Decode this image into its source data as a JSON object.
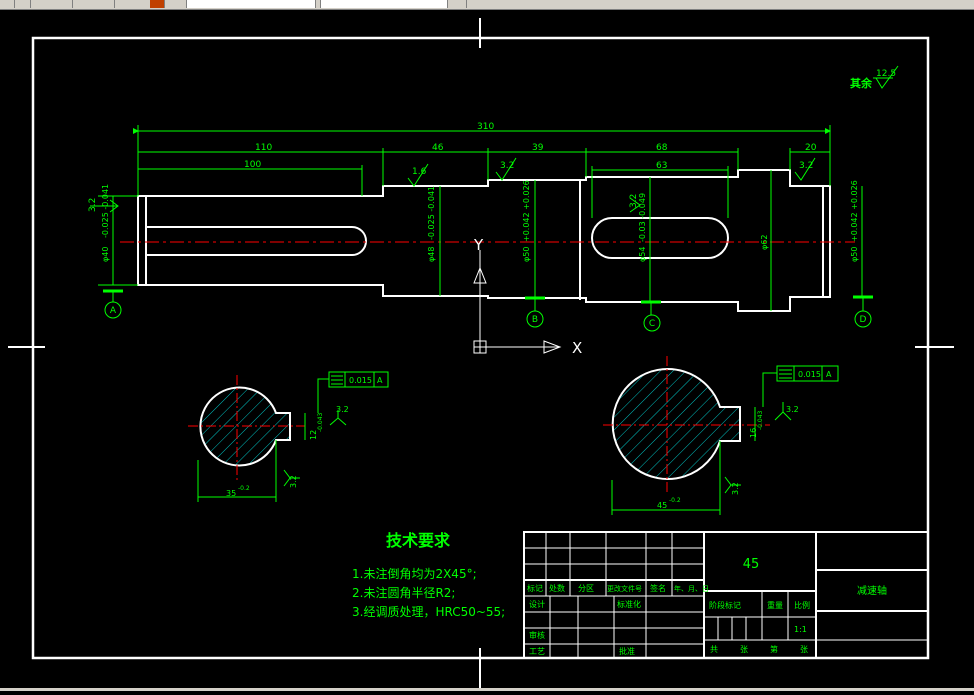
{
  "colors": {
    "background": "#000000",
    "frame": "#ffffff",
    "dimension": "#00ff00",
    "centerline": "#ff0000",
    "hatch": "#00c0c0",
    "text": "#00ff00"
  },
  "toolbar": {
    "icons": [
      "new-file-icon",
      "open-file-icon",
      "pan-icon",
      "undo-icon",
      "layer-icon",
      "properties-icon",
      "help-icon"
    ]
  },
  "drawing": {
    "roughness_note": {
      "label": "其余",
      "value": "12.5"
    },
    "dims_top": {
      "total": "310",
      "d110": "110",
      "d100": "100",
      "d46": "46",
      "d39": "39",
      "d68": "68",
      "d63": "63",
      "d20": "20"
    },
    "roughness": {
      "r1": "1.6",
      "r2": "3.2",
      "r3": "3.2",
      "r4": "3.2",
      "r5": "3.2",
      "r6": "3.2"
    },
    "diameters": {
      "d40": "φ40",
      "d40_tol": "-0.025 -0.041",
      "d48": "φ48",
      "d48_tol": "-0.025 -0.041",
      "d50a": "φ50",
      "d50a_tol": "+0.042 +0.026",
      "d54": "φ54",
      "d54_tol": "-0.03 -0.049",
      "d62": "φ62",
      "d50b": "φ50",
      "d50b_tol": "+0.042 +0.026"
    },
    "datums": [
      "A",
      "B",
      "C",
      "D"
    ],
    "axes": {
      "y": "Y",
      "x": "X"
    },
    "section_left": {
      "tolerance": "0.015",
      "datum": "A",
      "key_dim": "12",
      "key_tol": "-0.043",
      "diameter": "35",
      "diameter_tol": "-0.2",
      "roughness_a": "3.2",
      "roughness_b": "3.2"
    },
    "section_right": {
      "tolerance": "0.015",
      "datum": "A",
      "key_dim": "16",
      "key_tol": "-0.043",
      "diameter": "45",
      "diameter_tol": "-0.2",
      "roughness_a": "3.2",
      "roughness_b": "3.2"
    }
  },
  "tech_requirements": {
    "title": "技术要求",
    "items": [
      "1.未注倒角均为2X45°;",
      "2.未注圆角半径R2;",
      "3.经调质处理，HRC50~55;"
    ]
  },
  "title_block": {
    "material": "45",
    "part_name": "减速轴",
    "labels": {
      "mark": "标记",
      "count": "处数",
      "zone": "分区",
      "change_doc": "更改文件号",
      "signature": "签名",
      "date": "年、月、日",
      "design": "设计",
      "standardize": "标准化",
      "review": "审核",
      "process": "工艺",
      "approve": "批准",
      "stage_mark": "阶段标记",
      "weight": "重量",
      "scale": "比例",
      "sheets_total": "共",
      "sheet_n": "张",
      "sheet_of": "第",
      "sheet_m": "张"
    },
    "scale_value": "1:1"
  }
}
